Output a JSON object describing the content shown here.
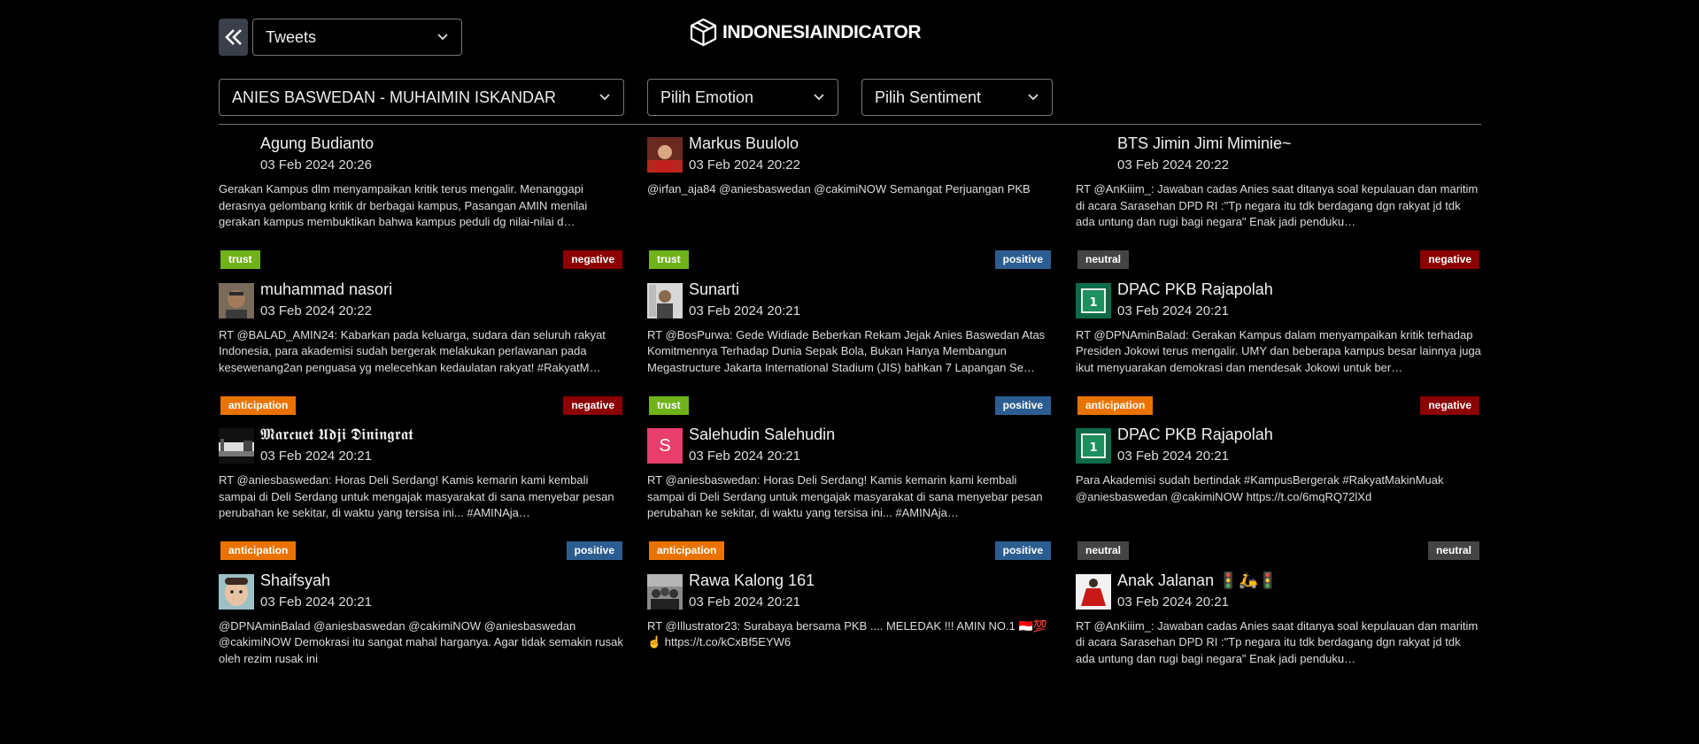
{
  "header": {
    "view_select": "Tweets",
    "logo_text": "INDONESIAINDICATOR"
  },
  "filters": {
    "candidate": "ANIES BASWEDAN - MUHAIMIN ISKANDAR",
    "emotion": "Pilih Emotion",
    "sentiment": "Pilih Sentiment"
  },
  "colors": {
    "trust": "#6fb21a",
    "anticipation": "#ea7300",
    "neutral": "#444444",
    "negative": "#8b0000",
    "positive": "#2c5d91",
    "avatar_s": "#e83e6c"
  },
  "tweets": [
    {
      "author": "Agung Budianto",
      "date": "03 Feb 2024 20:26",
      "avatar": "none",
      "text": "Gerakan Kampus dlm menyampaikan kritik terus mengalir. Menanggapi derasnya gelombang kritik dr berbagai kampus, Pasangan AMIN menilai gerakan kampus membuktikan bahwa kampus peduli dg nilai-nilai d…",
      "emotion": "trust",
      "sentiment": "negative"
    },
    {
      "author": "Markus Buulolo",
      "date": "03 Feb 2024 20:22",
      "avatar": "photo-red",
      "text": "@irfan_aja84 @aniesbaswedan @cakimiNOW Semangat Perjuangan PKB",
      "emotion": "trust",
      "sentiment": "positive"
    },
    {
      "author": "BTS Jimin Jimi Miminie~",
      "date": "03 Feb 2024 20:22",
      "avatar": "none",
      "text": "RT @AnKiiim_: Jawaban cadas Anies saat ditanya soal kepulauan dan maritim di acara Sarasehan DPD RI :\"Tp negara itu tdk berdagang dgn rakyat jd tdk ada untung dan rugi bagi negara\" Enak jadi penduku…",
      "emotion": "neutral",
      "sentiment": "negative"
    },
    {
      "author": "muhammad nasori",
      "date": "03 Feb 2024 20:22",
      "avatar": "photo-man",
      "text": "RT @BALAD_AMIN24: Kabarkan pada keluarga, sudara dan seluruh rakyat Indonesia, para akademisi sudah bergerak melakukan perlawanan pada kesewenang2an penguasa yg melecehkan kedaulatan rakyat! #RakyatM…",
      "emotion": "anticipation",
      "sentiment": "negative"
    },
    {
      "author": "Sunarti",
      "date": "03 Feb 2024 20:21",
      "avatar": "photo-portrait",
      "text": "RT @BosPurwa: Gede Widiade Beberkan Rekam Jejak Anies Baswedan Atas Komitmennya Terhadap Dunia Sepak Bola, Bukan Hanya Membangun Megastructure Jakarta International Stadium (JIS) bahkan 7 Lapangan Se…",
      "emotion": "trust",
      "sentiment": "positive"
    },
    {
      "author": "DPAC PKB Rajapolah",
      "date": "03 Feb 2024 20:21",
      "avatar": "pkb",
      "text": "RT @DPNAminBalad: Gerakan Kampus dalam menyampaikan kritik terhadap Presiden Jokowi terus mengalir. UMY dan beberapa kampus besar lainnya juga ikut menyuarakan demokrasi dan mendesak Jokowi untuk ber…",
      "emotion": "anticipation",
      "sentiment": "negative"
    },
    {
      "author": "𝕸𝖆𝖗𝖈𝖚𝖊𝖙 𝖀𝖉𝖏𝖎 𝕯𝖎𝖓𝖎𝖓𝖌𝖗𝖆𝖙",
      "date": "03 Feb 2024 20:21",
      "avatar": "photo-landscape",
      "text": "RT @aniesbaswedan: Horas Deli Serdang! Kamis kemarin kami kembali sampai di Deli Serdang untuk mengajak masyarakat di sana menyebar pesan perubahan ke sekitar, di waktu yang tersisa ini... #AMINAja…",
      "emotion": "anticipation",
      "sentiment": "positive"
    },
    {
      "author": "Salehudin Salehudin",
      "date": "03 Feb 2024 20:21",
      "avatar": "letter",
      "avatar_letter": "S",
      "text": "RT @aniesbaswedan: Horas Deli Serdang! Kamis kemarin kami kembali sampai di Deli Serdang untuk mengajak masyarakat di sana menyebar pesan perubahan ke sekitar, di waktu yang tersisa ini... #AMINAja…",
      "emotion": "anticipation",
      "sentiment": "positive"
    },
    {
      "author": "DPAC PKB Rajapolah",
      "date": "03 Feb 2024 20:21",
      "avatar": "pkb",
      "text": "Para Akademisi sudah bertindak #KampusBergerak #RakyatMakinMuak @aniesbaswedan @cakimiNOW https://t.co/6mqRQ72lXd",
      "emotion": "neutral",
      "sentiment": "neutral"
    },
    {
      "author": "Shaifsyah",
      "date": "03 Feb 2024 20:21",
      "avatar": "photo-face",
      "text": "@DPNAminBalad @aniesbaswedan @cakimiNOW @aniesbaswedan @cakimiNOW Demokrasi itu sangat mahal harganya. Agar tidak semakin rusak oleh rezim rusak ini",
      "emotion": "",
      "sentiment": ""
    },
    {
      "author": "Rawa Kalong 161",
      "date": "03 Feb 2024 20:21",
      "avatar": "photo-group",
      "text": "RT @Illustrator23: Surabaya bersama PKB .... MELEDAK !!! AMIN NO.1 🇮🇩💯☝️ https://t.co/kCxBf5EYW6",
      "emotion": "",
      "sentiment": ""
    },
    {
      "author": "Anak Jalanan 🚦🛵🚦",
      "date": "03 Feb 2024 20:21",
      "avatar": "photo-dress",
      "text": "RT @AnKiiim_: Jawaban cadas Anies saat ditanya soal kepulauan dan maritim di acara Sarasehan DPD RI :\"Tp negara itu tdk berdagang dgn rakyat jd tdk ada untung dan rugi bagi negara\" Enak jadi penduku…",
      "emotion": "",
      "sentiment": ""
    }
  ]
}
